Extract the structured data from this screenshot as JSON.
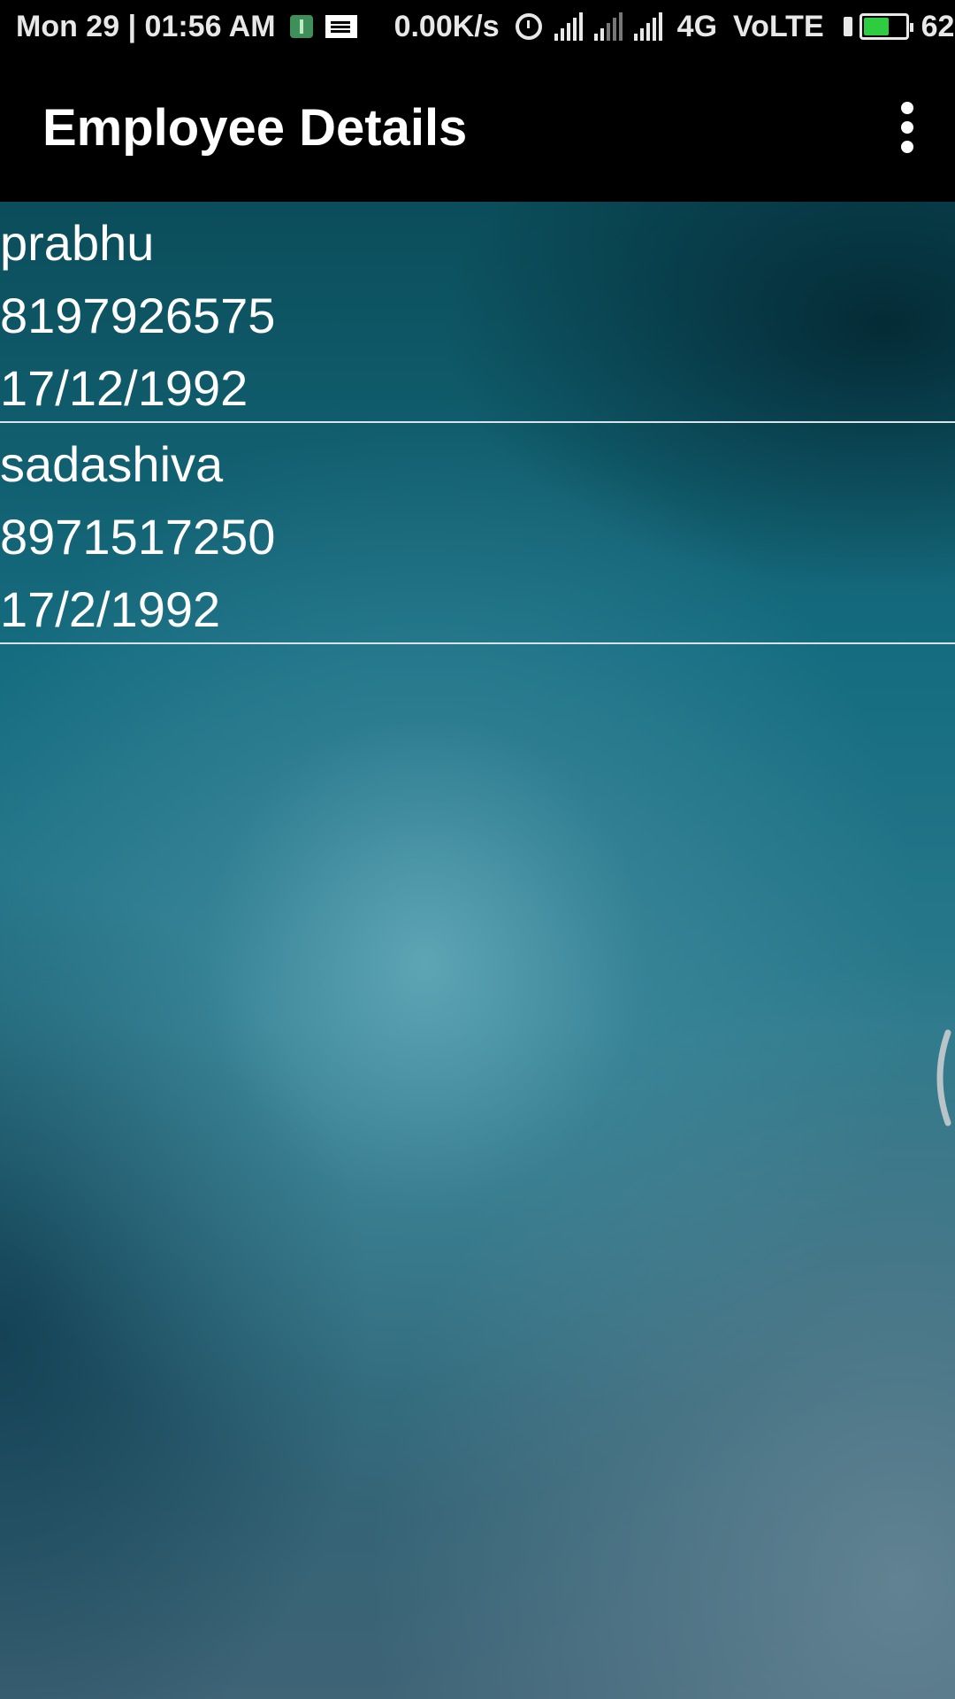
{
  "status_bar": {
    "datetime": "Mon 29 | 01:56 AM",
    "net_speed": "0.00K/s",
    "network_type": "4G",
    "volte": "VoLTE",
    "battery_level": "62",
    "battery_fraction": 0.62
  },
  "app_bar": {
    "title": "Employee Details",
    "menu_icon": "more-vertical-icon"
  },
  "employees": [
    {
      "name": "prabhu",
      "phone": "8197926575",
      "dob": "17/12/1992"
    },
    {
      "name": "sadashiva",
      "phone": "8971517250",
      "dob": "17/2/1992"
    }
  ],
  "colors": {
    "app_bar": "#000000",
    "divider": "#d8e4e8",
    "text": "#ffffff",
    "battery": "#2ecc40"
  }
}
